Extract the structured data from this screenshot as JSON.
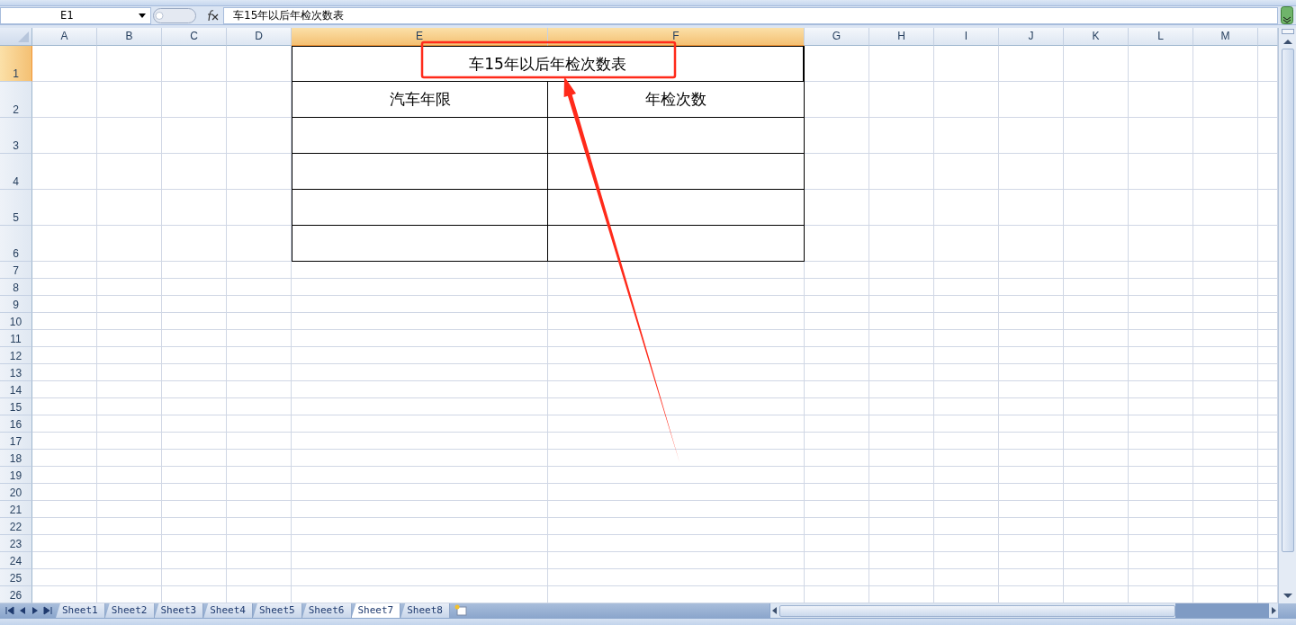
{
  "name_box": {
    "value": "E1"
  },
  "formula_bar": {
    "value": "车15年以后年检次数表"
  },
  "columns": [
    {
      "label": "A",
      "selected": false
    },
    {
      "label": "B",
      "selected": false
    },
    {
      "label": "C",
      "selected": false
    },
    {
      "label": "D",
      "selected": false
    },
    {
      "label": "E",
      "selected": true
    },
    {
      "label": "F",
      "selected": true
    },
    {
      "label": "G",
      "selected": false
    },
    {
      "label": "H",
      "selected": false
    },
    {
      "label": "I",
      "selected": false
    },
    {
      "label": "J",
      "selected": false
    },
    {
      "label": "K",
      "selected": false
    },
    {
      "label": "L",
      "selected": false
    },
    {
      "label": "M",
      "selected": false
    }
  ],
  "rows": [
    {
      "label": "1",
      "selected": true
    },
    {
      "label": "2",
      "selected": false
    },
    {
      "label": "3",
      "selected": false
    },
    {
      "label": "4",
      "selected": false
    },
    {
      "label": "5",
      "selected": false
    },
    {
      "label": "6",
      "selected": false
    },
    {
      "label": "7",
      "selected": false
    },
    {
      "label": "8",
      "selected": false
    },
    {
      "label": "9",
      "selected": false
    },
    {
      "label": "10",
      "selected": false
    },
    {
      "label": "11",
      "selected": false
    },
    {
      "label": "12",
      "selected": false
    },
    {
      "label": "13",
      "selected": false
    },
    {
      "label": "14",
      "selected": false
    },
    {
      "label": "15",
      "selected": false
    },
    {
      "label": "16",
      "selected": false
    },
    {
      "label": "17",
      "selected": false
    },
    {
      "label": "18",
      "selected": false
    },
    {
      "label": "19",
      "selected": false
    },
    {
      "label": "20",
      "selected": false
    },
    {
      "label": "21",
      "selected": false
    },
    {
      "label": "22",
      "selected": false
    },
    {
      "label": "23",
      "selected": false
    },
    {
      "label": "24",
      "selected": false
    },
    {
      "label": "25",
      "selected": false
    },
    {
      "label": "26",
      "selected": false
    }
  ],
  "table": {
    "title": "车15年以后年检次数表",
    "headers": [
      "汽车年限",
      "年检次数"
    ]
  },
  "sheet_tabs": [
    {
      "label": "Sheet1",
      "selected": false
    },
    {
      "label": "Sheet2",
      "selected": false
    },
    {
      "label": "Sheet3",
      "selected": false
    },
    {
      "label": "Sheet4",
      "selected": false
    },
    {
      "label": "Sheet5",
      "selected": false
    },
    {
      "label": "Sheet6",
      "selected": false
    },
    {
      "label": "Sheet7",
      "selected": true
    },
    {
      "label": "Sheet8",
      "selected": false
    }
  ]
}
